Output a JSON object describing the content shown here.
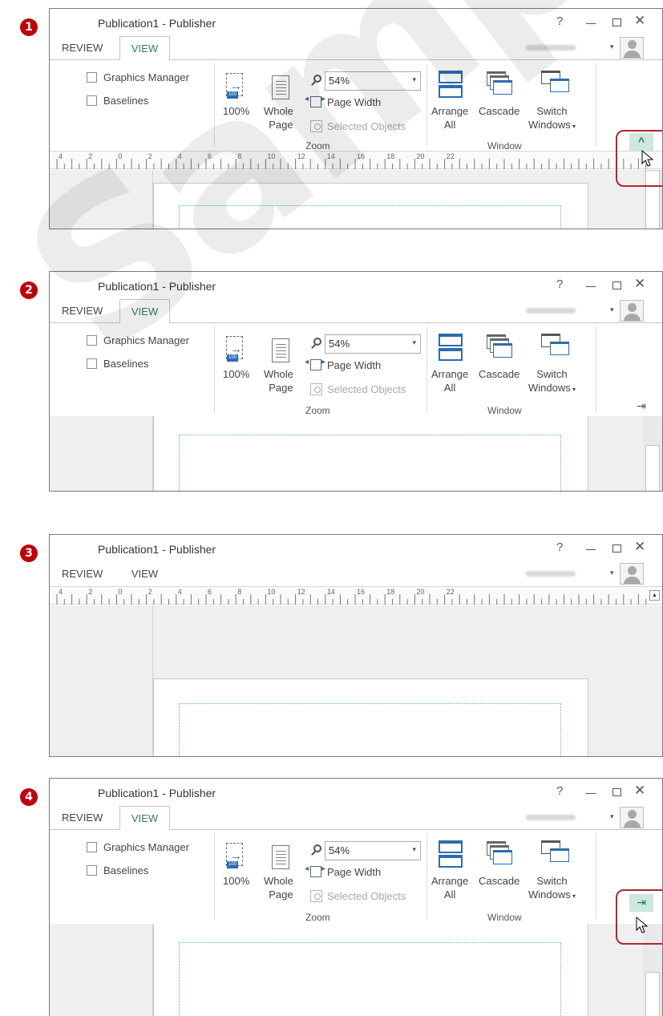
{
  "steps": [
    {
      "number": "1",
      "ribbon": true,
      "ruler": true,
      "control": "collapse",
      "callout": true
    },
    {
      "number": "2",
      "ribbon": true,
      "ruler": false,
      "control": "pin",
      "callout": false
    },
    {
      "number": "3",
      "ribbon": false,
      "ruler": true,
      "control": "none",
      "callout": false
    },
    {
      "number": "4",
      "ribbon": true,
      "ruler": false,
      "control": "pin-highlight",
      "callout": true
    }
  ],
  "window": {
    "title": "Publication1 - Publisher",
    "help": "?",
    "minimize": "–",
    "close": "✕"
  },
  "tabs": {
    "review": "REVIEW",
    "view": "VIEW"
  },
  "ribbon": {
    "show": {
      "graphics_manager": "Graphics Manager",
      "baselines": "Baselines"
    },
    "zoom": {
      "percent_100": "100%",
      "whole_page_line1": "Whole",
      "whole_page_line2": "Page",
      "zoom_value": "54%",
      "page_width": "Page Width",
      "selected_objects": "Selected Objects",
      "group_label": "Zoom"
    },
    "window": {
      "arrange_line1": "Arrange",
      "arrange_line2": "All",
      "cascade": "Cascade",
      "switch_line1": "Switch",
      "switch_line2": "Windows",
      "group_label": "Window"
    },
    "collapse_glyph": "^",
    "pin_glyph": "⇥"
  },
  "ruler": {
    "labels": [
      "4",
      "2",
      "0",
      "2",
      "4",
      "6",
      "8",
      "10",
      "12",
      "14",
      "16",
      "18",
      "20",
      "22"
    ]
  },
  "colors": {
    "badge": "#c0000a",
    "callout": "#b2262d",
    "accent_green": "#2e7d5c",
    "accent_blue": "#2b6cb0"
  },
  "watermark": "Sample"
}
